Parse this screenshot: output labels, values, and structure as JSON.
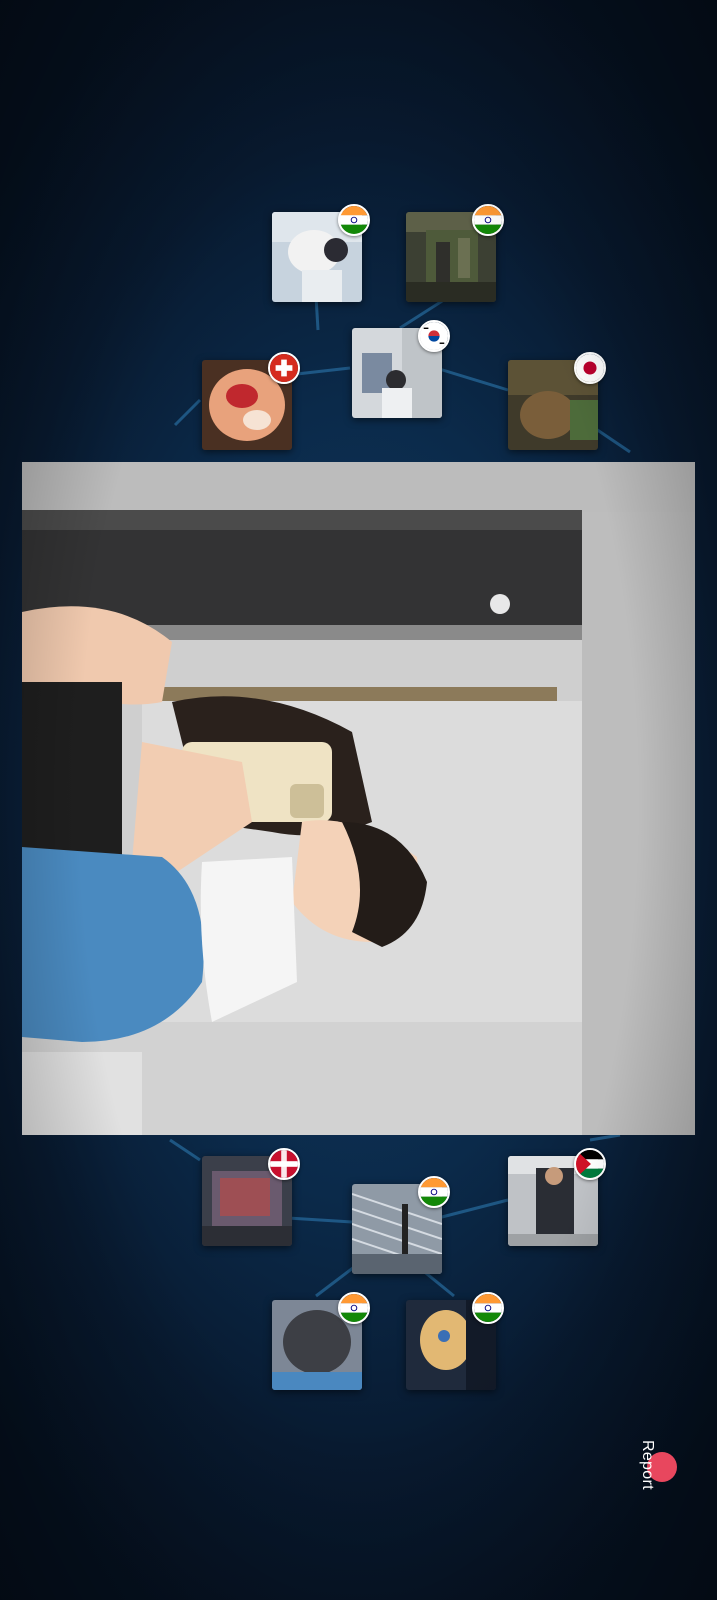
{
  "report": {
    "label": "Report"
  },
  "main_photo": {
    "subject": "mirror-selfie"
  },
  "top_cluster": [
    {
      "flag": "india-flag-icon"
    },
    {
      "flag": "india-flag-icon"
    },
    {
      "flag": "south-korea-flag-icon"
    },
    {
      "flag": "switzerland-flag-icon"
    },
    {
      "flag": "japan-flag-icon"
    }
  ],
  "bottom_cluster": [
    {
      "flag": "jordan-flag-icon"
    },
    {
      "flag": "india-flag-icon"
    },
    {
      "flag": "red-flag-icon"
    },
    {
      "flag": "india-flag-icon"
    },
    {
      "flag": "india-flag-icon"
    }
  ],
  "colors": {
    "background": "#0b2a4a",
    "connector": "#2f7fb8",
    "report_badge": "#e8475e"
  }
}
